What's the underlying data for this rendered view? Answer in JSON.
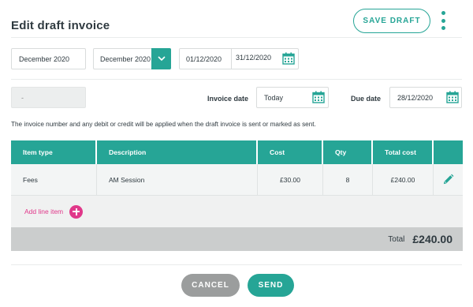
{
  "header": {
    "title": "Edit draft invoice",
    "save_label": "SAVE DRAFT"
  },
  "filters": {
    "period_input": "December 2020",
    "period_select": "December 2020",
    "date_from": "01/12/2020",
    "date_to": "31/12/2020"
  },
  "invoice": {
    "number_value": "-",
    "invoice_date_label": "Invoice date",
    "invoice_date_value": "Today",
    "due_date_label": "Due date",
    "due_date_value": "28/12/2020",
    "note": "The invoice number and any debit or credit will be applied when the draft invoice is sent or marked as sent."
  },
  "table": {
    "headers": [
      "Item type",
      "Description",
      "Cost",
      "Qty",
      "Total cost"
    ],
    "rows": [
      {
        "item_type": "Fees",
        "description": "AM Session",
        "cost": "£30.00",
        "qty": "8",
        "total": "£240.00"
      }
    ],
    "add_line_label": "Add line item",
    "total_label": "Total",
    "total_value": "£240.00"
  },
  "footer": {
    "cancel_label": "CANCEL",
    "send_label": "SEND"
  },
  "colors": {
    "accent": "#26a596",
    "pink": "#e0388a",
    "grey_button": "#9b9d9d"
  },
  "icons": [
    "kebab-menu-icon",
    "chevron-down-icon",
    "calendar-icon",
    "pencil-icon",
    "plus-circle-icon"
  ]
}
